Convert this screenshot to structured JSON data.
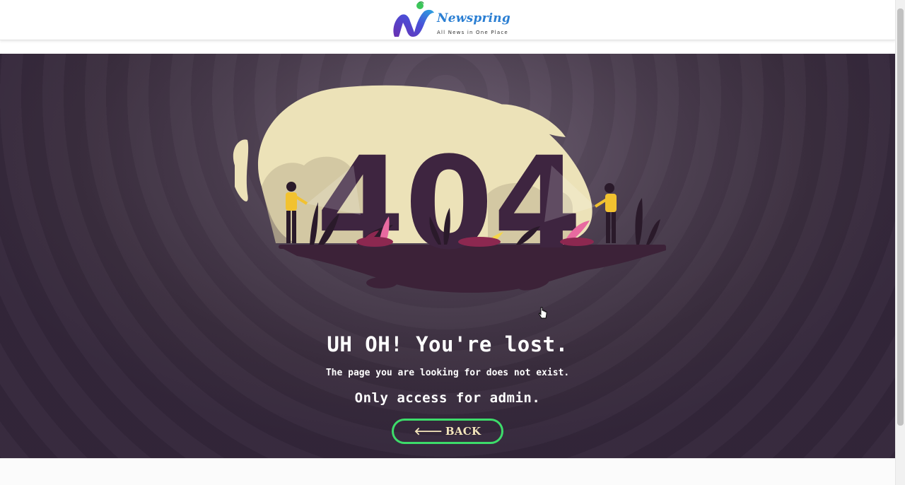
{
  "header": {
    "logo_name": "Newspring",
    "logo_tagline": "All News in One Place"
  },
  "illustration": {
    "code_text": "404"
  },
  "error": {
    "headline": "UH OH! You're lost.",
    "message": "The page you are looking for does not exist.",
    "notice": "Only access for admin."
  },
  "back_button": {
    "icon": "arrow-left-icon",
    "icon_glyph": "🡐",
    "label": "BACK"
  },
  "colors": {
    "accent_green": "#3ddc6a",
    "hero_background": "#4a3d4e",
    "cream": "#f3e4bb",
    "logo_blue": "#2b7fd3",
    "logo_purple": "#6a2fb0"
  }
}
